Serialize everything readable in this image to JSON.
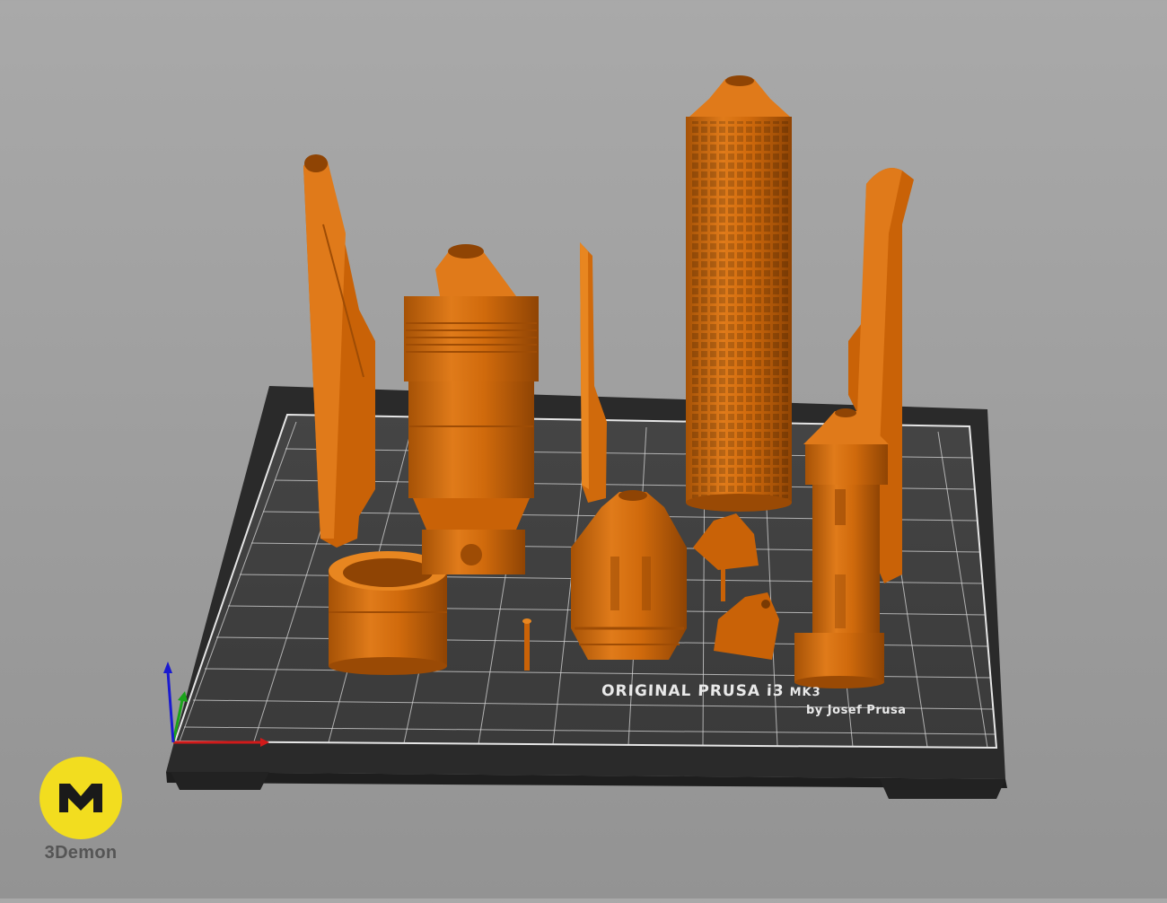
{
  "scene": {
    "printer_brand_line": "ORIGINAL PRUSA i3",
    "printer_model": "MK3",
    "printer_byline": "by Josef Prusa"
  },
  "logo": {
    "caption": "3Demon",
    "color": "#f2dd1f"
  },
  "colors": {
    "part_fill": "#d46b0a",
    "part_shadow": "#9e4c05",
    "part_highlight": "#ef8a2a",
    "bed_surface": "#3f3f3f",
    "bed_grid": "#d8d8d8",
    "bed_frame": "#2b2b2b",
    "axis_x": "#d11a1a",
    "axis_y": "#1aa31a",
    "axis_z": "#1a1ad1"
  },
  "icons": {
    "logo": "3demon-logo-icon",
    "axes": "xyz-axes-icon"
  }
}
